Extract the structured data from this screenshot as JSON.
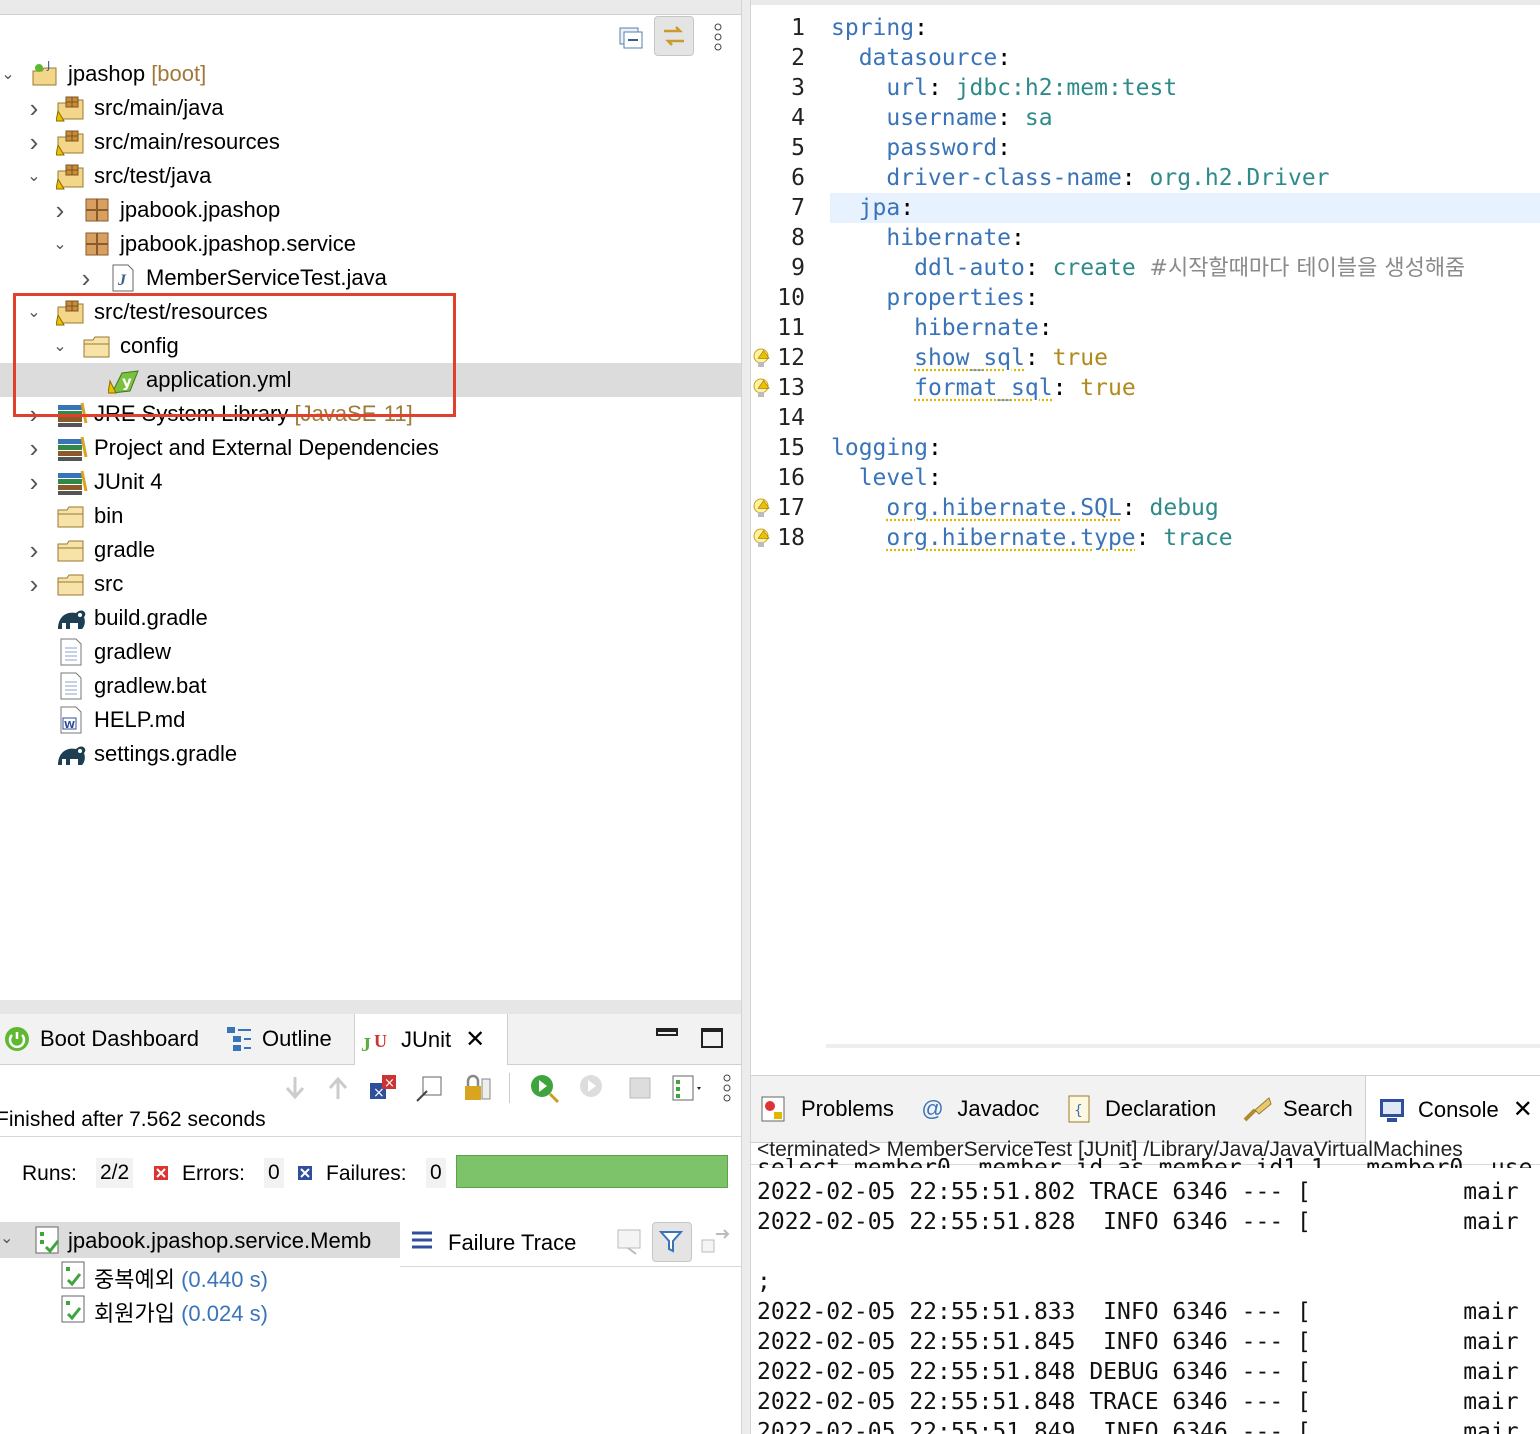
{
  "explorer": {
    "tree": [
      {
        "label": "jpashop",
        "decoration": " [boot]",
        "icon": "project-icon",
        "expanded": true,
        "level": 0
      },
      {
        "label": "src/main/java",
        "icon": "source-folder-icon",
        "expanded": false,
        "level": 1
      },
      {
        "label": "src/main/resources",
        "icon": "source-folder-icon",
        "expanded": false,
        "level": 1
      },
      {
        "label": "src/test/java",
        "icon": "source-folder-icon",
        "expanded": true,
        "level": 1
      },
      {
        "label": "jpabook.jpashop",
        "icon": "package-icon",
        "expanded": false,
        "level": 2
      },
      {
        "label": "jpabook.jpashop.service",
        "icon": "package-icon",
        "expanded": true,
        "level": 2
      },
      {
        "label": "MemberServiceTest.java",
        "icon": "java-file-icon",
        "expanded": false,
        "level": 3
      },
      {
        "label": "src/test/resources",
        "icon": "source-folder-icon",
        "expanded": true,
        "level": 1
      },
      {
        "label": "config",
        "icon": "folder-icon",
        "expanded": true,
        "level": 2
      },
      {
        "label": "application.yml",
        "icon": "yaml-file-icon",
        "level": 3,
        "selected": true
      },
      {
        "label": "JRE System Library",
        "decoration": " [JavaSE-11]",
        "icon": "library-icon",
        "expanded": false,
        "level": 1
      },
      {
        "label": "Project and External Dependencies",
        "icon": "library-icon",
        "expanded": false,
        "level": 1
      },
      {
        "label": "JUnit 4",
        "icon": "library-icon",
        "expanded": false,
        "level": 1
      },
      {
        "label": "bin",
        "icon": "folder-icon",
        "level": 1
      },
      {
        "label": "gradle",
        "icon": "folder-icon",
        "expanded": false,
        "level": 1
      },
      {
        "label": "src",
        "icon": "folder-icon",
        "expanded": false,
        "level": 1
      },
      {
        "label": "build.gradle",
        "icon": "gradle-file-icon",
        "level": 1
      },
      {
        "label": "gradlew",
        "icon": "text-file-icon",
        "level": 1
      },
      {
        "label": "gradlew.bat",
        "icon": "text-file-icon",
        "level": 1
      },
      {
        "label": "HELP.md",
        "icon": "markdown-file-icon",
        "level": 1
      },
      {
        "label": "settings.gradle",
        "icon": "gradle-file-icon",
        "level": 1
      }
    ]
  },
  "editor": {
    "lines": [
      {
        "n": "1",
        "parts": [
          [
            "k",
            "spring"
          ],
          [
            "p",
            ":"
          ]
        ]
      },
      {
        "n": "2",
        "parts": [
          [
            "p",
            "  "
          ],
          [
            "k",
            "datasource"
          ],
          [
            "p",
            ":"
          ]
        ]
      },
      {
        "n": "3",
        "parts": [
          [
            "p",
            "    "
          ],
          [
            "k",
            "url"
          ],
          [
            "p",
            ": "
          ],
          [
            "v",
            "jdbc:h2:mem:test"
          ]
        ]
      },
      {
        "n": "4",
        "parts": [
          [
            "p",
            "    "
          ],
          [
            "k",
            "username"
          ],
          [
            "p",
            ": "
          ],
          [
            "v",
            "sa"
          ]
        ]
      },
      {
        "n": "5",
        "parts": [
          [
            "p",
            "    "
          ],
          [
            "k",
            "password"
          ],
          [
            "p",
            ":"
          ]
        ]
      },
      {
        "n": "6",
        "parts": [
          [
            "p",
            "    "
          ],
          [
            "k",
            "driver-class-name"
          ],
          [
            "p",
            ": "
          ],
          [
            "v",
            "org.h2.Driver"
          ]
        ]
      },
      {
        "n": "7",
        "parts": [
          [
            "p",
            "  "
          ],
          [
            "k",
            "jpa"
          ],
          [
            "p",
            ":"
          ]
        ],
        "current": true
      },
      {
        "n": "8",
        "parts": [
          [
            "p",
            "    "
          ],
          [
            "k",
            "hibernate"
          ],
          [
            "p",
            ":"
          ]
        ]
      },
      {
        "n": "9",
        "parts": [
          [
            "p",
            "      "
          ],
          [
            "k",
            "ddl-auto"
          ],
          [
            "p",
            ": "
          ],
          [
            "v",
            "create "
          ],
          [
            "c",
            "#시작할때마다 테이블을 생성해줌"
          ]
        ]
      },
      {
        "n": "10",
        "parts": [
          [
            "p",
            "    "
          ],
          [
            "k",
            "properties"
          ],
          [
            "p",
            ":"
          ]
        ]
      },
      {
        "n": "11",
        "parts": [
          [
            "p",
            "      "
          ],
          [
            "k",
            "hibernate"
          ],
          [
            "p",
            ":"
          ]
        ]
      },
      {
        "n": "12",
        "parts": [
          [
            "p",
            "      "
          ],
          [
            "kw",
            "show_sql"
          ],
          [
            "p",
            ": "
          ],
          [
            "b",
            "true"
          ]
        ],
        "warn": true
      },
      {
        "n": "13",
        "parts": [
          [
            "p",
            "      "
          ],
          [
            "kw",
            "format_sql"
          ],
          [
            "p",
            ": "
          ],
          [
            "b",
            "true"
          ]
        ],
        "warn": true
      },
      {
        "n": "14",
        "parts": []
      },
      {
        "n": "15",
        "parts": [
          [
            "k",
            "logging"
          ],
          [
            "p",
            ":"
          ]
        ]
      },
      {
        "n": "16",
        "parts": [
          [
            "p",
            "  "
          ],
          [
            "k",
            "level"
          ],
          [
            "p",
            ":"
          ]
        ]
      },
      {
        "n": "17",
        "parts": [
          [
            "p",
            "    "
          ],
          [
            "kw",
            "org.hibernate.SQL"
          ],
          [
            "p",
            ": "
          ],
          [
            "v",
            "debug"
          ]
        ],
        "warn": true
      },
      {
        "n": "18",
        "parts": [
          [
            "p",
            "    "
          ],
          [
            "kw",
            "org.hibernate.type"
          ],
          [
            "p",
            ": "
          ],
          [
            "v",
            "trace"
          ]
        ],
        "warn": true
      }
    ]
  },
  "junit_view": {
    "tabs": {
      "boot_dashboard": "Boot Dashboard",
      "outline": "Outline",
      "junit": "JUnit"
    },
    "status": "Finished after 7.562 seconds",
    "runs_label": "Runs:",
    "runs_value": "2/2",
    "errors_label": "Errors:",
    "errors_value": "0",
    "failures_label": "Failures:",
    "failures_value": "0",
    "progress_fraction": 1.0,
    "suite_label": "jpabook.jpashop.service.Memb",
    "failure_trace_label": "Failure Trace",
    "tests": [
      {
        "name": "중복예외",
        "time": "(0.440 s)"
      },
      {
        "name": "회원가입",
        "time": "(0.024 s)"
      }
    ]
  },
  "console_view": {
    "tabs": {
      "problems": "Problems",
      "javadoc": "Javadoc",
      "declaration": "Declaration",
      "search": "Search",
      "console": "Console"
    },
    "header": "<terminated> MemberServiceTest [JUnit] /Library/Java/JavaVirtualMachines",
    "lines": [
      "2022-02-05 22:55:51.802 TRACE 6346 --- [           mair",
      "2022-02-05 22:55:51.828  INFO 6346 --- [           mair",
      "",
      ";",
      "2022-02-05 22:55:51.833  INFO 6346 --- [           mair",
      "2022-02-05 22:55:51.845  INFO 6346 --- [           mair",
      "2022-02-05 22:55:51.848 DEBUG 6346 --- [           mair",
      "2022-02-05 22:55:51.848 TRACE 6346 --- [           mair",
      "2022-02-05 22:55:51.849  INFO 6346 --- [           mair"
    ]
  },
  "colors": {
    "highlight_box": "#e0402c",
    "progress_bar": "#7cc36a",
    "yaml_key": "#3a74b8",
    "yaml_value": "#2f8a8a"
  }
}
